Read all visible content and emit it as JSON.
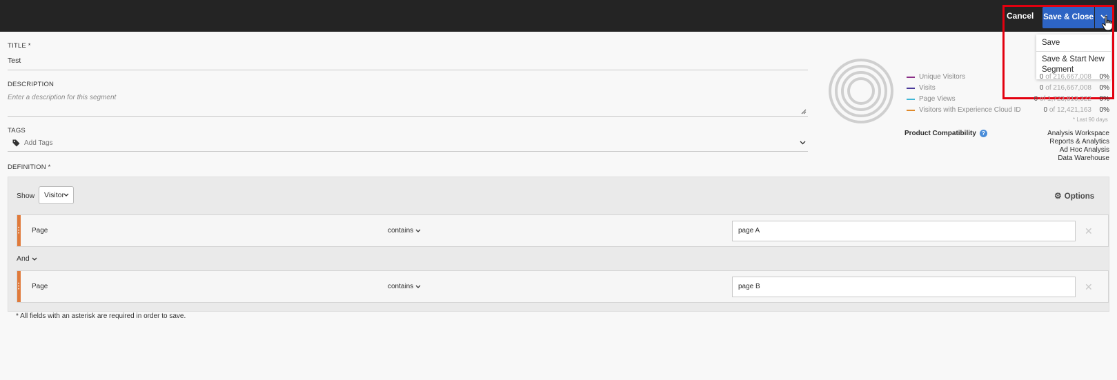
{
  "header": {
    "cancel_label": "Cancel",
    "save_close_label": "Save & Close",
    "menu": {
      "save_label": "Save",
      "save_new_label": "Save & Start New Segment"
    }
  },
  "form": {
    "title_label": "TITLE *",
    "title_value": "Test",
    "description_label": "DESCRIPTION",
    "description_placeholder": "Enter a description for this segment",
    "tags_label": "TAGS",
    "tags_placeholder": "Add Tags",
    "definition_label": "DEFINITION *"
  },
  "definition": {
    "show_label": "Show",
    "show_value": "Visitor",
    "options_label": "Options",
    "rules": [
      {
        "dimension": "Page",
        "operator": "contains",
        "value": "page A"
      },
      {
        "dimension": "Page",
        "operator": "contains",
        "value": "page B"
      }
    ],
    "logic_operator": "And",
    "required_note": "* All fields with an asterisk are required in order to save."
  },
  "summary": {
    "metrics": [
      {
        "name": "Unique Visitors",
        "count": "0",
        "of": "of 216,667,008",
        "percent": "0%",
        "color": "#8b2f87"
      },
      {
        "name": "Visits",
        "count": "0",
        "of": "of 216,667,008",
        "percent": "0%",
        "color": "#4b3a9a"
      },
      {
        "name": "Page Views",
        "count": "0",
        "of": "of 1,723,813,322",
        "percent": "0%",
        "color": "#3fb6d6"
      },
      {
        "name": "Visitors with Experience Cloud ID",
        "count": "0",
        "of": "of 12,421,163",
        "percent": "0%",
        "color": "#e08a2b"
      }
    ],
    "footnote": "* Last 90 days",
    "compatibility_label": "Product Compatibility",
    "compatibility": [
      "Analysis Workspace",
      "Reports & Analytics",
      "Ad Hoc Analysis",
      "Data Warehouse"
    ]
  },
  "colors": {
    "topbar": "#242424",
    "primary": "#2d64c4",
    "highlight": "#e3000f",
    "rule_handle": "#e07a3a"
  },
  "icons": [
    "chevron-down-icon",
    "hand-cursor-icon",
    "tag-icon",
    "gear-icon",
    "help-icon",
    "close-icon",
    "resize-grip-icon"
  ]
}
